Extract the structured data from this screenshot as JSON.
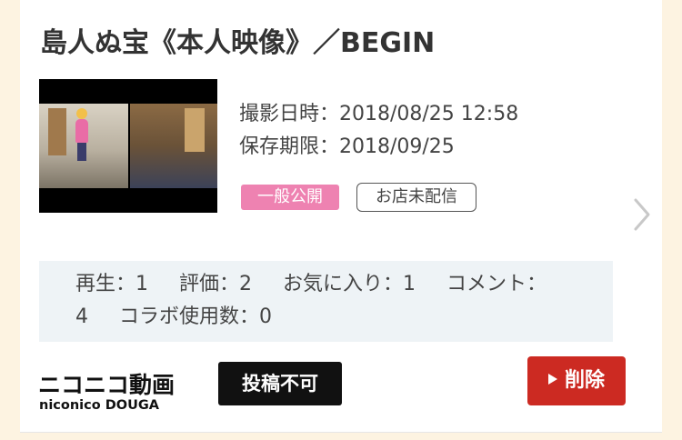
{
  "title": "島人ぬ宝《本人映像》／BEGIN",
  "meta": {
    "shot_datetime": "撮影日時：2018/08/25 12:58",
    "expiry": "保存期限：2018/09/25"
  },
  "badges": {
    "public": "一般公開",
    "store": "お店未配信"
  },
  "stats": {
    "plays": "再生：1",
    "rating": "評価：2",
    "favorites": "お気に入り：1",
    "comments": "コメント：4",
    "collabs": "コラボ使用数：0"
  },
  "logo": {
    "line1": "ニコニコ動画",
    "line2": "niconico DOUGA"
  },
  "buttons": {
    "post_disabled": "投稿不可",
    "delete": "削除"
  },
  "icons": {
    "next": "chevron-right-icon",
    "play": "play-triangle-icon"
  },
  "colors": {
    "page_bg": "#fdf3e1",
    "public_badge": "#ee82b1",
    "delete_button": "#cc2a22",
    "post_disabled_button": "#111111",
    "stats_bg": "#eef3f6"
  }
}
